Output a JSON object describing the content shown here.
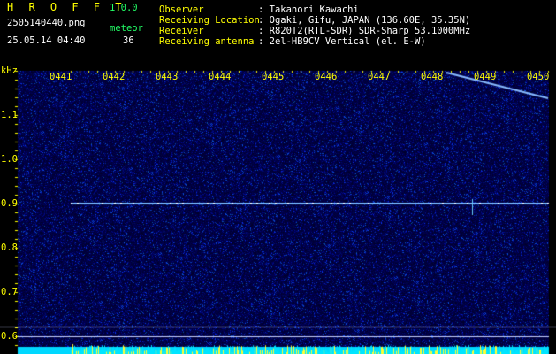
{
  "header": {
    "app_name": "H R O F F T",
    "version": "1.0.0",
    "filename": "2505140440.png",
    "datetime": "25.05.14 04:40",
    "meteor_label": "meteor",
    "meteor_count": "36",
    "info": [
      {
        "label": "Observer",
        "value": ": Takanori Kawachi"
      },
      {
        "label": "Receiving Location",
        "value": ": Ogaki, Gifu, JAPAN (136.60E, 35.35N)"
      },
      {
        "label": "Receiver",
        "value": ": R820T2(RTL-SDR) SDR-Sharp 53.1000MHz"
      },
      {
        "label": "Receiving antenna",
        "value": ": 2el-HB9CV Vertical (el. E-W)"
      }
    ]
  },
  "axis": {
    "unit": "kHz",
    "y_ticks": [
      "1.1",
      "1.0",
      "0.9",
      "0.8",
      "0.7",
      "0.6"
    ],
    "x_ticks": [
      "0441",
      "0442",
      "0443",
      "0444",
      "0445",
      "0446",
      "0447",
      "0448",
      "0449",
      "0450"
    ]
  },
  "colors": {
    "background": "#000000",
    "spectrogram_bg": "#00003a",
    "label_yellow": "#ffff00",
    "label_green": "#22ff66",
    "trace_blue": "#66aaff",
    "activity_cyan": "#00e5ff"
  }
}
